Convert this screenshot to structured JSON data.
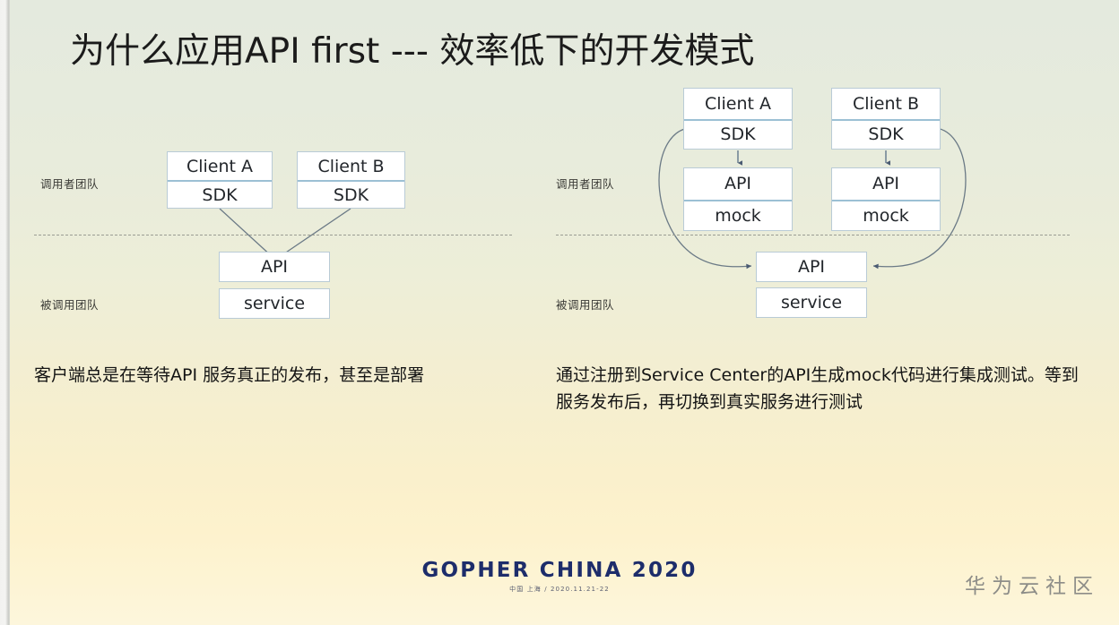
{
  "slide": {
    "title": "为什么应用API first --- 效率低下的开发模式",
    "background": {
      "top_color": "#e4eade",
      "bottom_color": "#fdf6dc"
    },
    "box_border_color": "#b9cbd6",
    "box_divider_color": "#9cc0d4",
    "arrow_color": "#4a5b72"
  },
  "left_diagram": {
    "name": "current-mode-diagram",
    "labels": {
      "caller_team": "调用者团队",
      "callee_team": "被调用团队"
    },
    "client_a": {
      "top": "Client A",
      "bottom": "SDK"
    },
    "client_b": {
      "top": "Client B",
      "bottom": "SDK"
    },
    "api": "API",
    "service": "service"
  },
  "right_diagram": {
    "name": "api-first-mode-diagram",
    "labels": {
      "caller_team": "调用者团队",
      "callee_team": "被调用团队"
    },
    "client_a": {
      "top": "Client A",
      "bottom": "SDK"
    },
    "client_b": {
      "top": "Client B",
      "bottom": "SDK"
    },
    "mock_a": {
      "top": "API",
      "bottom": "mock"
    },
    "mock_b": {
      "top": "API",
      "bottom": "mock"
    },
    "api": "API",
    "service": "service"
  },
  "captions": {
    "left": "客户端总是在等待API 服务真正的发布，甚至是部署",
    "right": "通过注册到Service Center的API生成mock代码进行集成测试。等到服务发布后，再切换到真实服务进行测试"
  },
  "footer": {
    "conference_name": "GOPHER CHINA 2020",
    "conference_sub": "中国 上海 / 2020.11.21-22",
    "brand": "华为云社区"
  }
}
